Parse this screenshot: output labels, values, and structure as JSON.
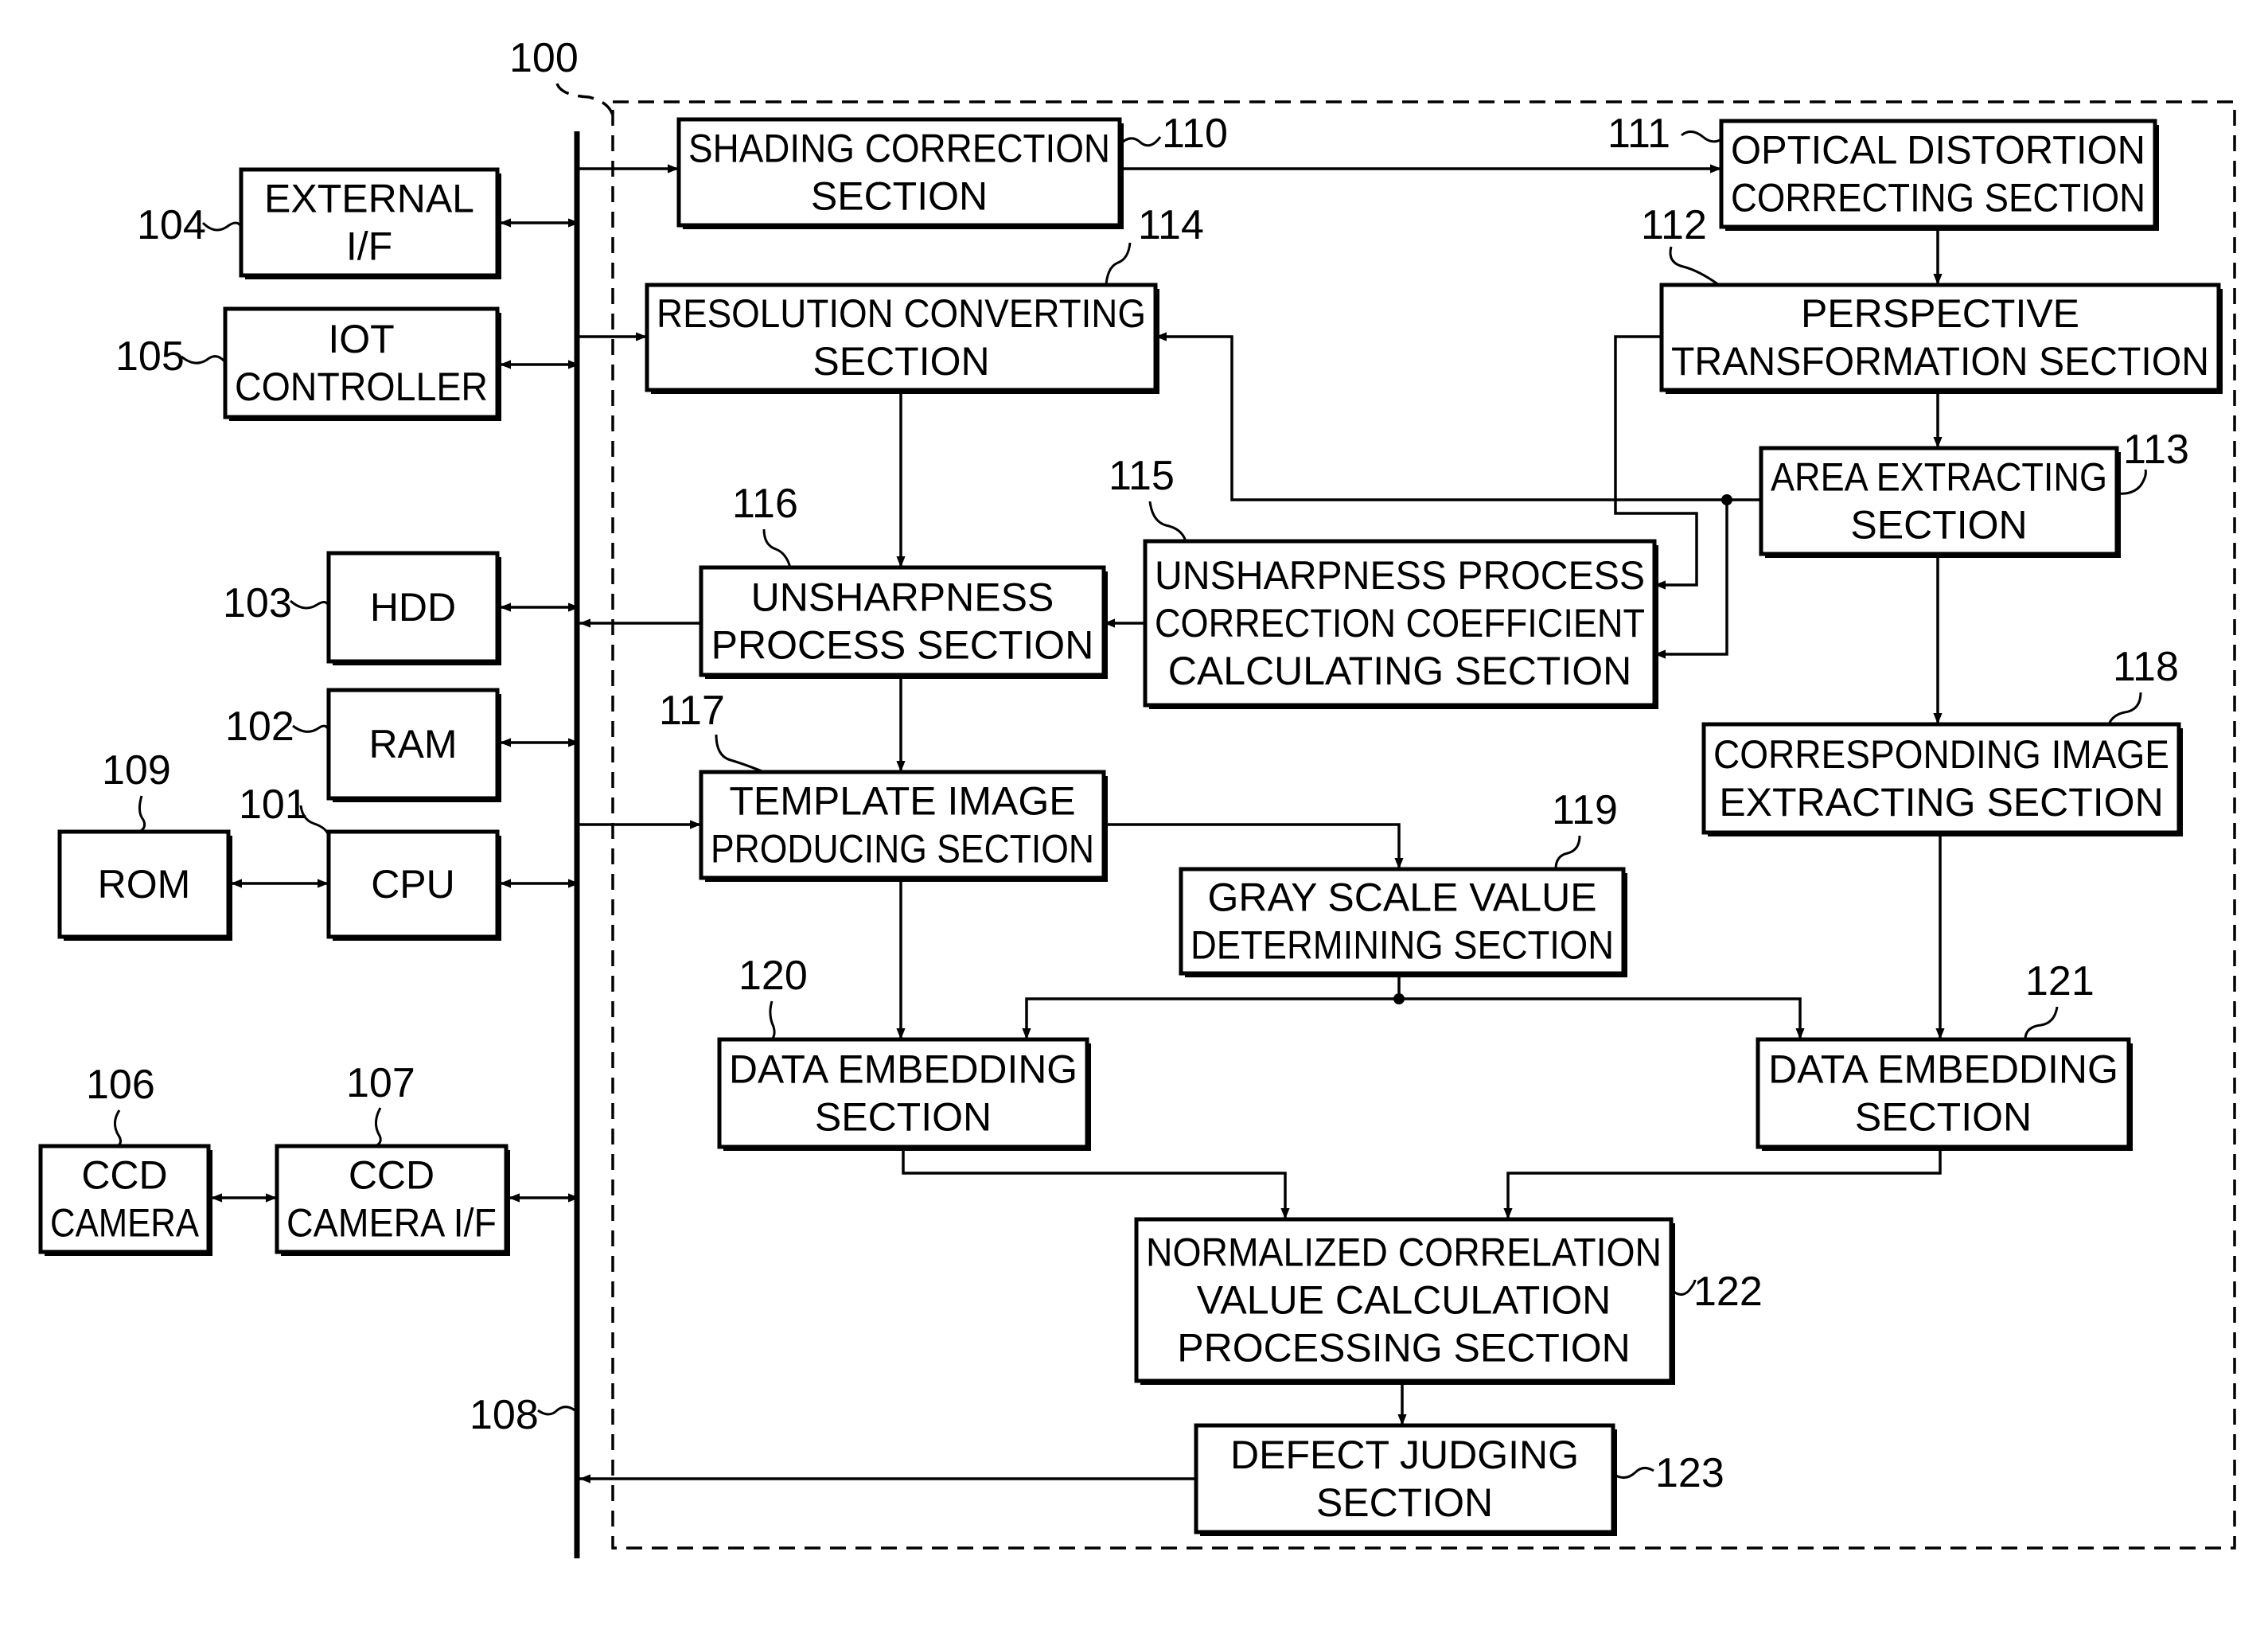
{
  "figure": {
    "system_ref": "100",
    "bus_ref": "108"
  },
  "blocks": {
    "external_if": {
      "ref": "104",
      "lines": [
        "EXTERNAL",
        "I/F"
      ]
    },
    "iot_controller": {
      "ref": "105",
      "lines": [
        "IOT",
        "CONTROLLER"
      ]
    },
    "hdd": {
      "ref": "103",
      "lines": [
        "HDD"
      ]
    },
    "ram": {
      "ref": "102",
      "lines": [
        "RAM"
      ]
    },
    "rom": {
      "ref": "109",
      "lines": [
        "ROM"
      ]
    },
    "cpu": {
      "ref": "101",
      "lines": [
        "CPU"
      ]
    },
    "ccd_camera": {
      "ref": "106",
      "lines": [
        "CCD",
        "CAMERA"
      ]
    },
    "ccd_camera_if": {
      "ref": "107",
      "lines": [
        "CCD",
        "CAMERA I/F"
      ]
    },
    "shading": {
      "ref": "110",
      "lines": [
        "SHADING CORRECTION",
        "SECTION"
      ]
    },
    "optical": {
      "ref": "111",
      "lines": [
        "OPTICAL DISTORTION",
        "CORRECTING SECTION"
      ]
    },
    "perspective": {
      "ref": "112",
      "lines": [
        "PERSPECTIVE",
        "TRANSFORMATION SECTION"
      ]
    },
    "area": {
      "ref": "113",
      "lines": [
        "AREA EXTRACTING",
        "SECTION"
      ]
    },
    "resolution": {
      "ref": "114",
      "lines": [
        "RESOLUTION CONVERTING",
        "SECTION"
      ]
    },
    "coef": {
      "ref": "115",
      "lines": [
        "UNSHARPNESS PROCESS",
        "CORRECTION COEFFICIENT",
        "CALCULATING SECTION"
      ]
    },
    "unsharp": {
      "ref": "116",
      "lines": [
        "UNSHARPNESS",
        "PROCESS SECTION"
      ]
    },
    "template": {
      "ref": "117",
      "lines": [
        "TEMPLATE IMAGE",
        "PRODUCING SECTION"
      ]
    },
    "corresponding": {
      "ref": "118",
      "lines": [
        "CORRESPONDING IMAGE",
        "EXTRACTING SECTION"
      ]
    },
    "grayscale": {
      "ref": "119",
      "lines": [
        "GRAY SCALE VALUE",
        "DETERMINING SECTION"
      ]
    },
    "embed_left": {
      "ref": "120",
      "lines": [
        "DATA EMBEDDING",
        "SECTION"
      ]
    },
    "embed_right": {
      "ref": "121",
      "lines": [
        "DATA EMBEDDING",
        "SECTION"
      ]
    },
    "ncc": {
      "ref": "122",
      "lines": [
        "NORMALIZED CORRELATION",
        "VALUE CALCULATION",
        "PROCESSING SECTION"
      ]
    },
    "defect": {
      "ref": "123",
      "lines": [
        "DEFECT JUDGING",
        "SECTION"
      ]
    }
  }
}
